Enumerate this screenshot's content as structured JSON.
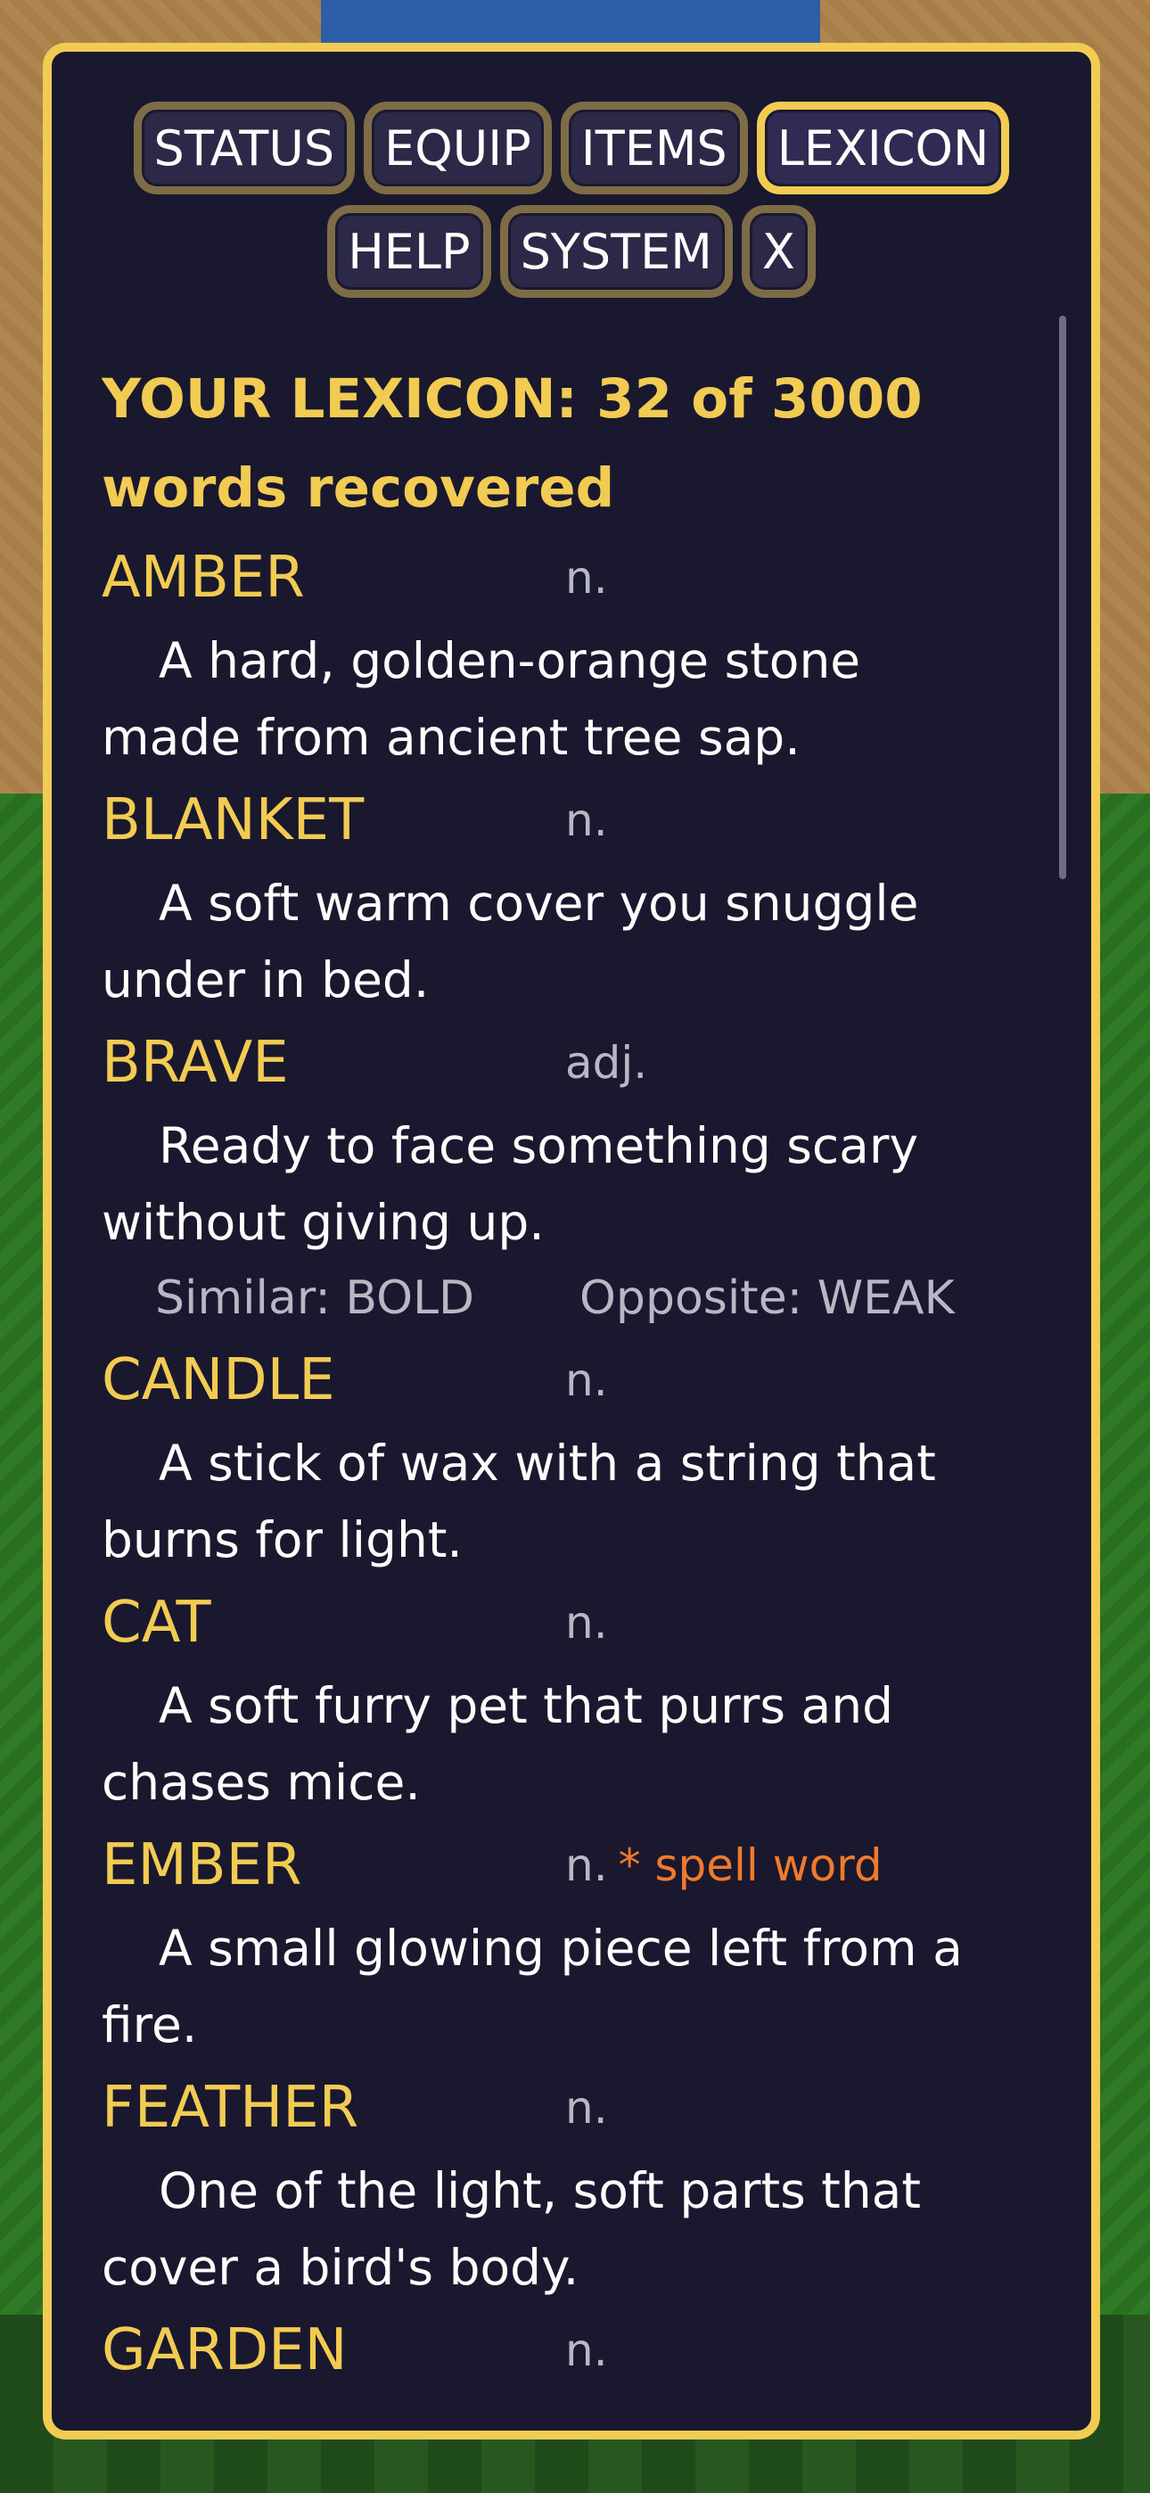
{
  "tabs_row1": [
    "STATUS",
    "EQUIP",
    "ITEMS",
    "LEXICON"
  ],
  "tabs_row2": [
    "HELP",
    "SYSTEM",
    "X"
  ],
  "active_tab": "LEXICON",
  "lexicon": {
    "heading": "YOUR LEXICON: 32 of 3000 words recovered",
    "entries": [
      {
        "word": "AMBER",
        "pos": "n.",
        "definition": "A hard, golden-orange stone made from ancient tree sap."
      },
      {
        "word": "BLANKET",
        "pos": "n.",
        "definition": "A soft warm cover you snuggle under in bed."
      },
      {
        "word": "BRAVE",
        "pos": "adj.",
        "definition": "Ready to face something scary without giving up.",
        "similar": "Similar: BOLD",
        "opposite": "Opposite: WEAK"
      },
      {
        "word": "CANDLE",
        "pos": "n.",
        "definition": "A stick of wax with a string that burns for light."
      },
      {
        "word": "CAT",
        "pos": "n.",
        "definition": "A soft furry pet that purrs and chases mice."
      },
      {
        "word": "EMBER",
        "pos": "n.",
        "tag": "* spell word",
        "definition": "A small glowing piece left from a fire."
      },
      {
        "word": "FEATHER",
        "pos": "n.",
        "definition": "One of the light, soft parts that cover a bird's body."
      },
      {
        "word": "GARDEN",
        "pos": "n.",
        "definition": ""
      }
    ]
  },
  "colors": {
    "panel_bg": "#19182e",
    "accent_gold": "#f2cc52",
    "spell_orange": "#f07a2c",
    "muted": "#b9b7c4"
  }
}
